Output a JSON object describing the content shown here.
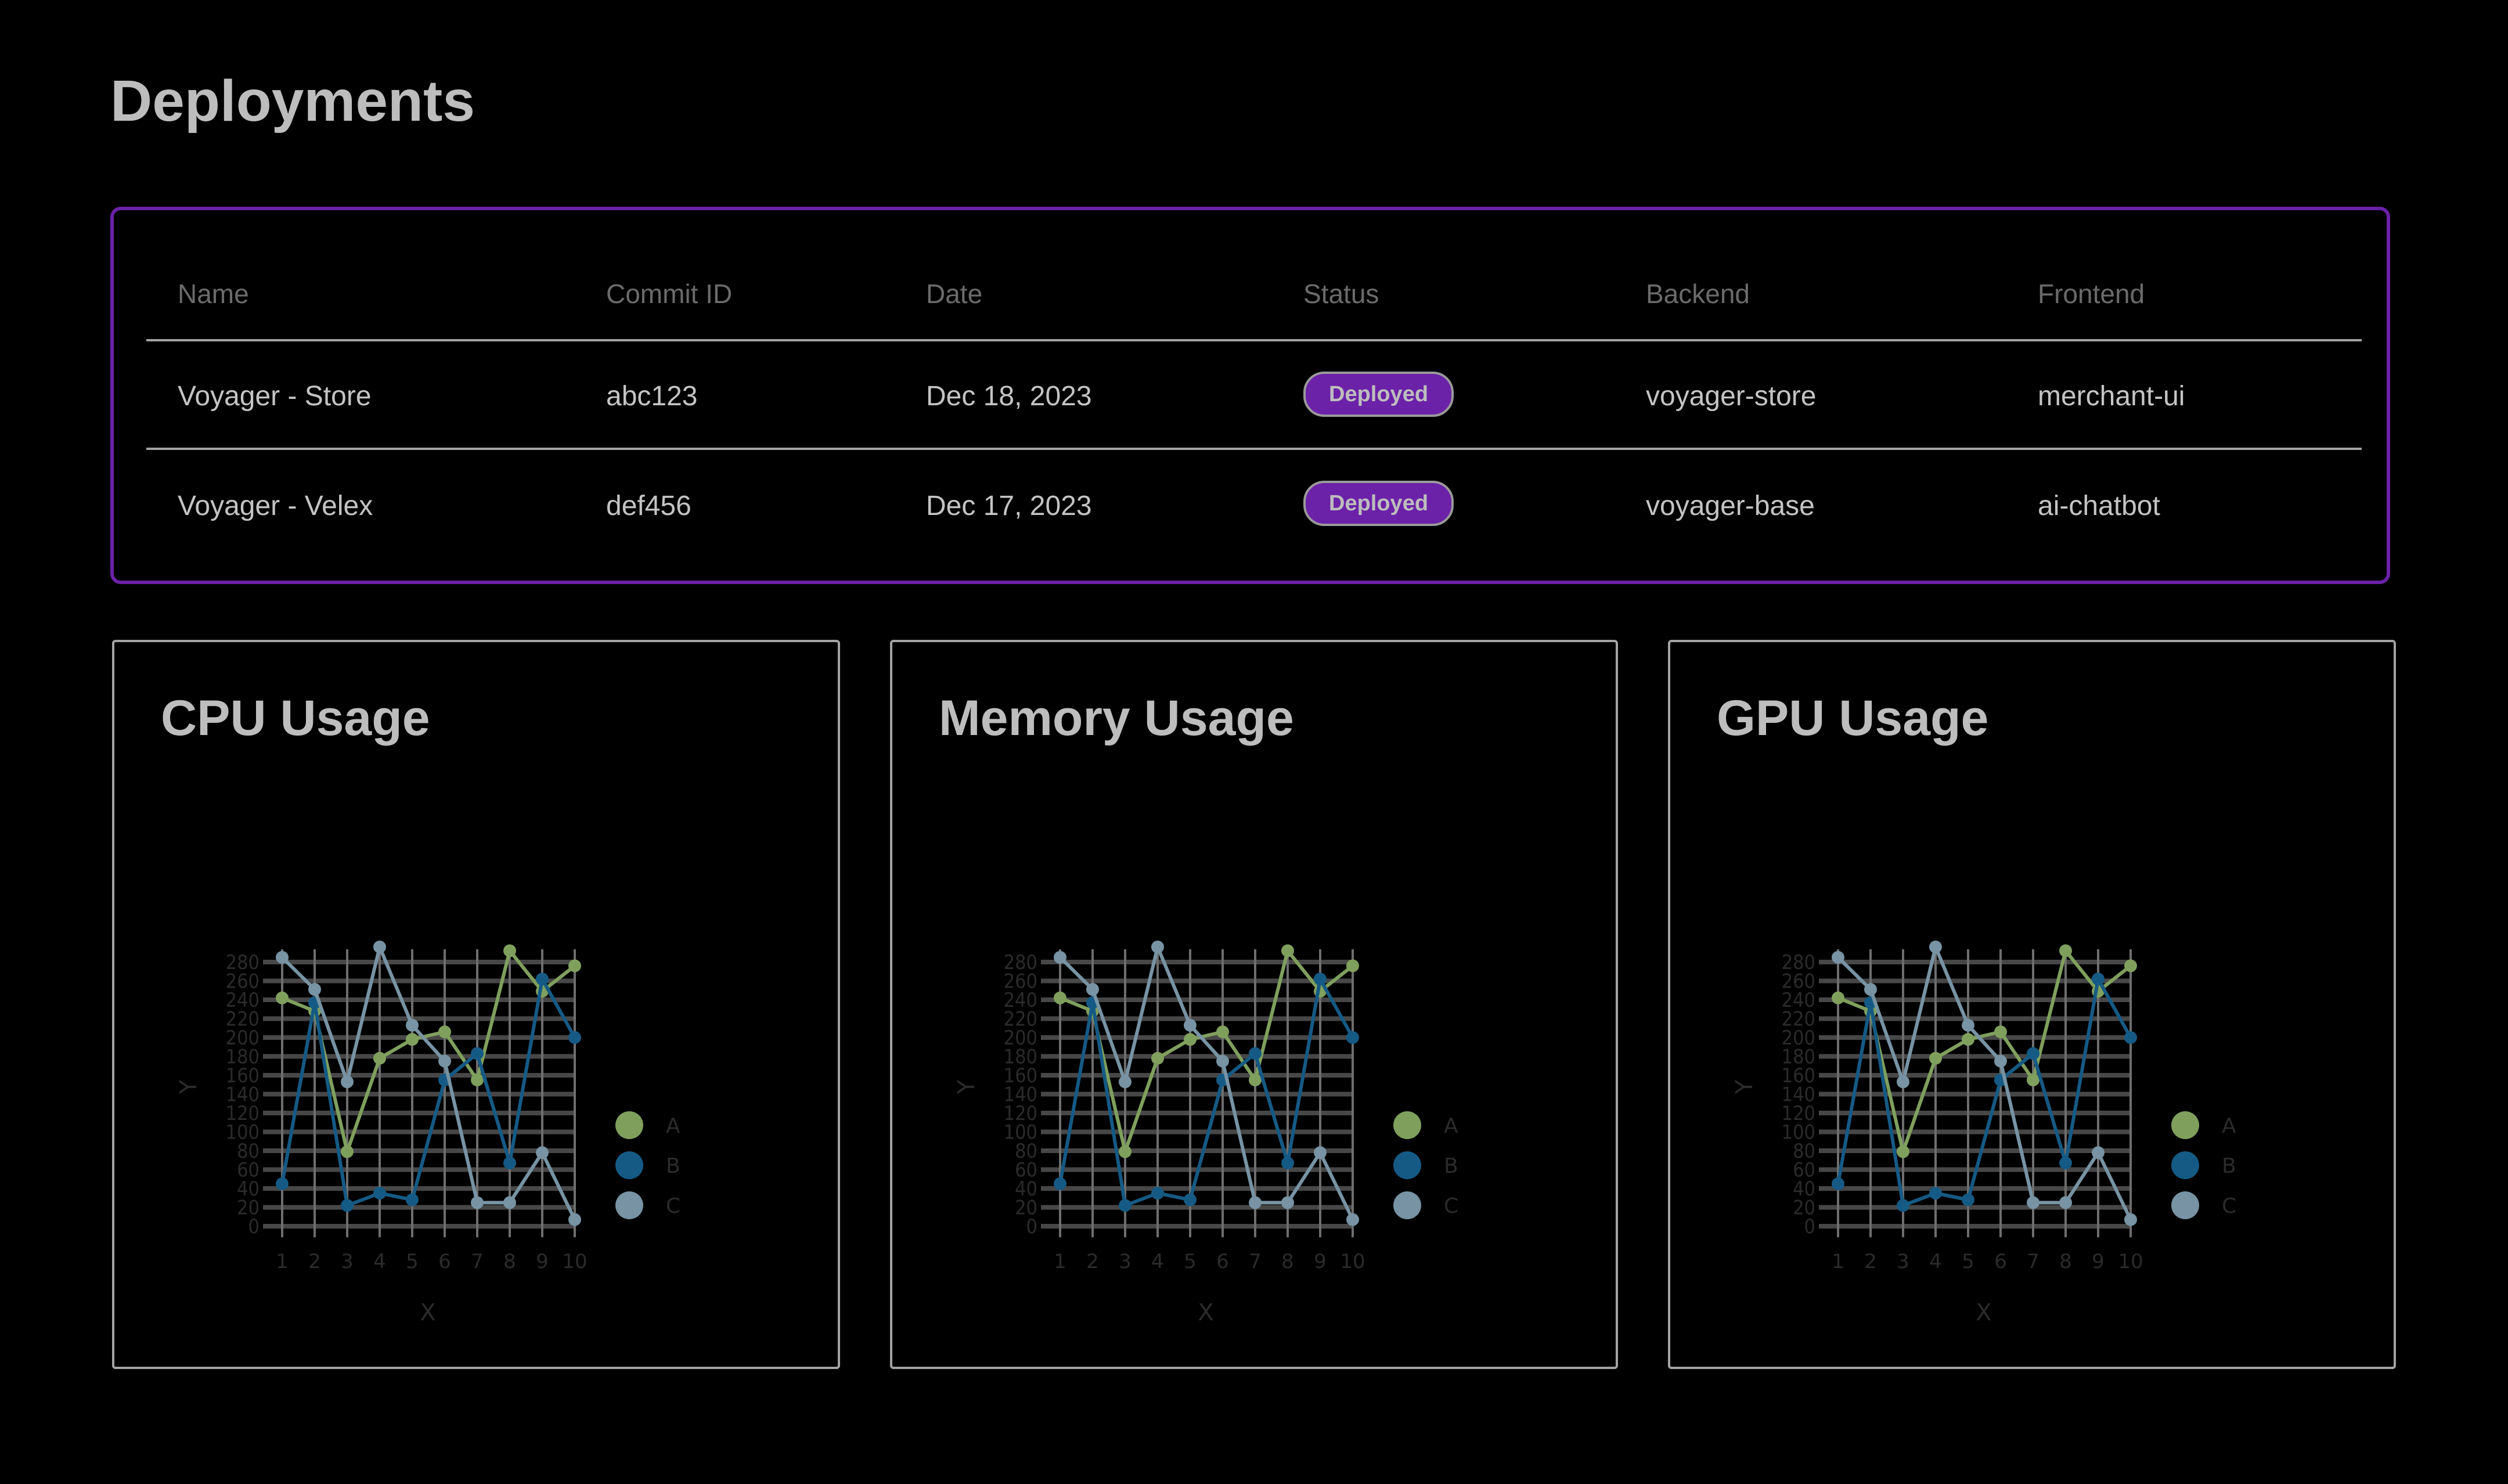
{
  "page": {
    "title": "Deployments"
  },
  "table": {
    "columns": [
      "Name",
      "Commit ID",
      "Date",
      "Status",
      "Backend",
      "Frontend"
    ],
    "rows": [
      {
        "name": "Voyager - Store",
        "commit": "abc123",
        "date": "Dec 18, 2023",
        "status": "Deployed",
        "backend": "voyager-store",
        "frontend": "merchant-ui"
      },
      {
        "name": "Voyager - Velex",
        "commit": "def456",
        "date": "Dec 17, 2023",
        "status": "Deployed",
        "backend": "voyager-base",
        "frontend": "ai-chatbot"
      }
    ],
    "accent_color": "#6b21a8"
  },
  "cards": [
    {
      "title": "CPU Usage"
    },
    {
      "title": "Memory Usage"
    },
    {
      "title": "GPU Usage"
    }
  ],
  "chart_data": [
    {
      "type": "line",
      "title": "CPU Usage",
      "xlabel": "X",
      "ylabel": "Y",
      "x": [
        1,
        2,
        3,
        4,
        5,
        6,
        7,
        8,
        9,
        10
      ],
      "xticks": [
        "1",
        "2",
        "3",
        "4",
        "5",
        "6",
        "7",
        "8",
        "9",
        "10"
      ],
      "yticks": [
        "0",
        "20",
        "40",
        "60",
        "80",
        "100",
        "120",
        "140",
        "160",
        "180",
        "200",
        "220",
        "240",
        "260",
        "280"
      ],
      "ylim": [
        0,
        280
      ],
      "grid": true,
      "legend": "right",
      "series": [
        {
          "name": "A",
          "color": "#7fa05d",
          "values": [
            242,
            228,
            79,
            178,
            198,
            206,
            155,
            292,
            249,
            276
          ]
        },
        {
          "name": "B",
          "color": "#155a85",
          "values": [
            45,
            237,
            22,
            35,
            28,
            155,
            183,
            67,
            262,
            200
          ]
        },
        {
          "name": "C",
          "color": "#7793a4",
          "values": [
            285,
            251,
            153,
            296,
            213,
            175,
            25,
            25,
            78,
            7
          ]
        }
      ]
    },
    {
      "type": "line",
      "title": "Memory Usage",
      "xlabel": "X",
      "ylabel": "Y",
      "x": [
        1,
        2,
        3,
        4,
        5,
        6,
        7,
        8,
        9,
        10
      ],
      "xticks": [
        "1",
        "2",
        "3",
        "4",
        "5",
        "6",
        "7",
        "8",
        "9",
        "10"
      ],
      "yticks": [
        "0",
        "20",
        "40",
        "60",
        "80",
        "100",
        "120",
        "140",
        "160",
        "180",
        "200",
        "220",
        "240",
        "260",
        "280"
      ],
      "ylim": [
        0,
        280
      ],
      "grid": true,
      "legend": "right",
      "series": [
        {
          "name": "A",
          "color": "#7fa05d",
          "values": [
            242,
            228,
            79,
            178,
            198,
            206,
            155,
            292,
            249,
            276
          ]
        },
        {
          "name": "B",
          "color": "#155a85",
          "values": [
            45,
            237,
            22,
            35,
            28,
            155,
            183,
            67,
            262,
            200
          ]
        },
        {
          "name": "C",
          "color": "#7793a4",
          "values": [
            285,
            251,
            153,
            296,
            213,
            175,
            25,
            25,
            78,
            7
          ]
        }
      ]
    },
    {
      "type": "line",
      "title": "GPU Usage",
      "xlabel": "X",
      "ylabel": "Y",
      "x": [
        1,
        2,
        3,
        4,
        5,
        6,
        7,
        8,
        9,
        10
      ],
      "xticks": [
        "1",
        "2",
        "3",
        "4",
        "5",
        "6",
        "7",
        "8",
        "9",
        "10"
      ],
      "yticks": [
        "0",
        "20",
        "40",
        "60",
        "80",
        "100",
        "120",
        "140",
        "160",
        "180",
        "200",
        "220",
        "240",
        "260",
        "280"
      ],
      "ylim": [
        0,
        280
      ],
      "grid": true,
      "legend": "right",
      "series": [
        {
          "name": "A",
          "color": "#7fa05d",
          "values": [
            242,
            228,
            79,
            178,
            198,
            206,
            155,
            292,
            249,
            276
          ]
        },
        {
          "name": "B",
          "color": "#155a85",
          "values": [
            45,
            237,
            22,
            35,
            28,
            155,
            183,
            67,
            262,
            200
          ]
        },
        {
          "name": "C",
          "color": "#7793a4",
          "values": [
            285,
            251,
            153,
            296,
            213,
            175,
            25,
            25,
            78,
            7
          ]
        }
      ]
    }
  ]
}
